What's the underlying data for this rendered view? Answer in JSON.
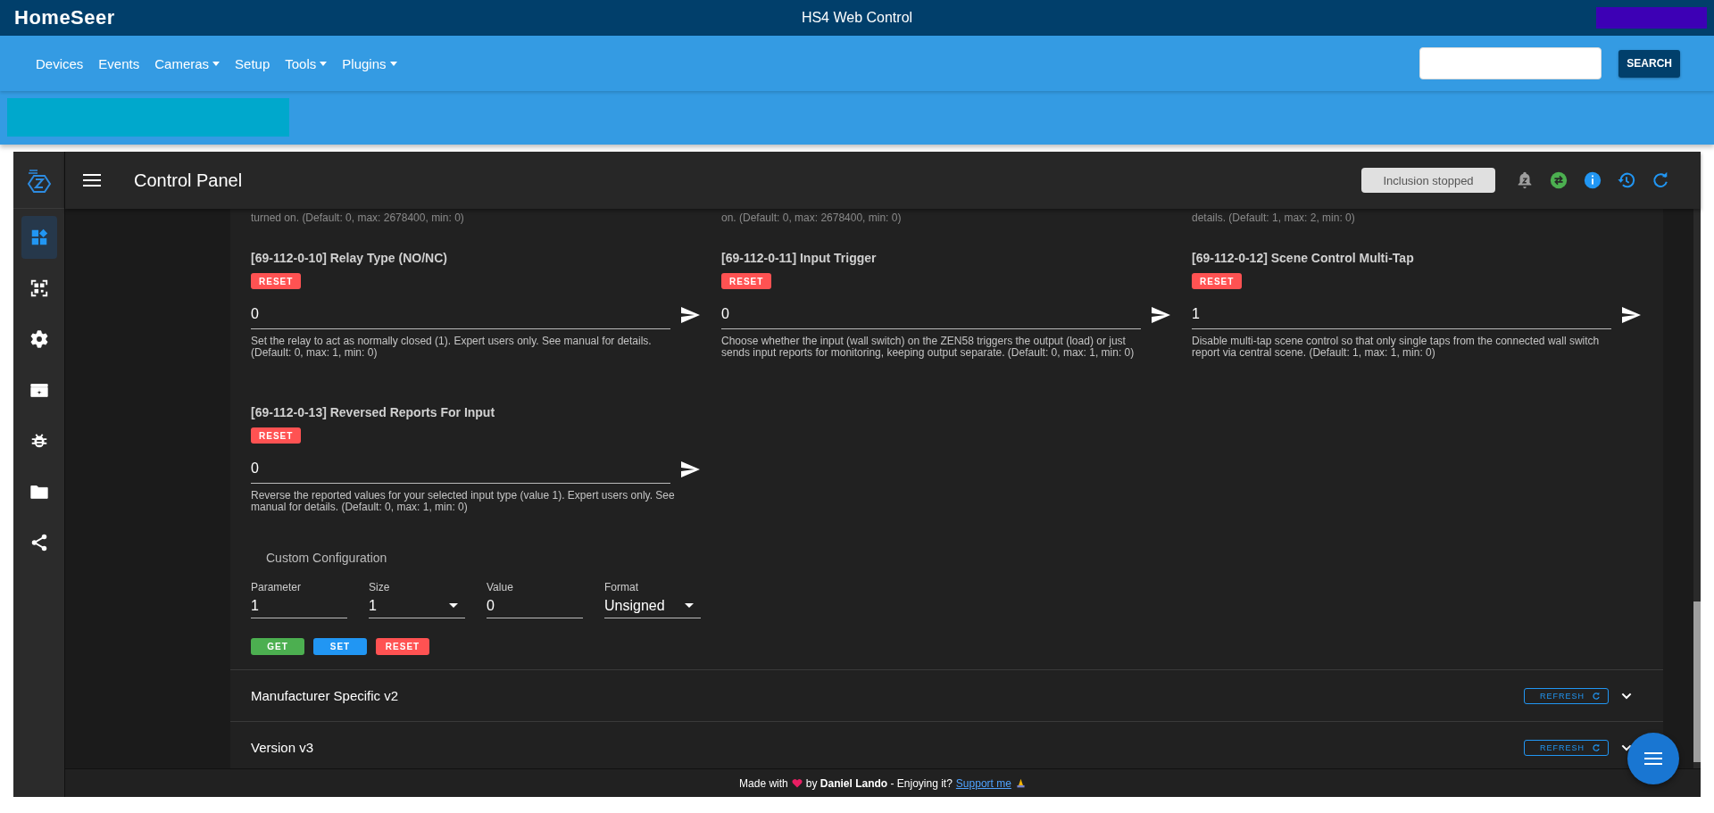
{
  "top_bar": {
    "logo": "HomeSeer",
    "title": "HS4 Web Control"
  },
  "nav": {
    "items": [
      {
        "label": "Devices",
        "dropdown": false
      },
      {
        "label": "Events",
        "dropdown": false
      },
      {
        "label": "Cameras",
        "dropdown": true
      },
      {
        "label": "Setup",
        "dropdown": false
      },
      {
        "label": "Tools",
        "dropdown": true
      },
      {
        "label": "Plugins",
        "dropdown": true
      }
    ],
    "search_button": "SEARCH"
  },
  "panel": {
    "title": "Control Panel",
    "inclusion_status": "Inclusion stopped",
    "sidebar": [
      {
        "kind": "dashboard",
        "selected": true
      },
      {
        "kind": "scan",
        "selected": false
      },
      {
        "kind": "settings",
        "selected": false
      },
      {
        "kind": "scenes",
        "selected": false
      },
      {
        "kind": "debug",
        "selected": false
      },
      {
        "kind": "files",
        "selected": false
      },
      {
        "kind": "share",
        "selected": false
      }
    ]
  },
  "cut_descriptions": [
    "turned on. (Default: 0, max: 2678400, min: 0)",
    "on. (Default: 0, max: 2678400, min: 0)",
    "details. (Default: 1, max: 2, min: 0)"
  ],
  "parameters": [
    {
      "title": "[69-112-0-10] Relay Type (NO/NC)",
      "reset": "RESET",
      "value": "0",
      "description": "Set the relay to act as normally closed (1). Expert users only. See manual for details. (Default: 0, max: 1, min: 0)"
    },
    {
      "title": "[69-112-0-11] Input Trigger",
      "reset": "RESET",
      "value": "0",
      "description": "Choose whether the input (wall switch) on the ZEN58 triggers the output (load) or just sends input reports for monitoring, keeping output separate. (Default: 0, max: 1, min: 0)"
    },
    {
      "title": "[69-112-0-12] Scene Control Multi-Tap",
      "reset": "RESET",
      "value": "1",
      "description": "Disable multi-tap scene control so that only single taps from the connected wall switch report via central scene. (Default: 1, max: 1, min: 0)"
    },
    {
      "title": "[69-112-0-13] Reversed Reports For Input",
      "reset": "RESET",
      "value": "0",
      "description": "Reverse the reported values for your selected input type (value 1). Expert users only. See manual for details. (Default: 0, max: 1, min: 0)"
    }
  ],
  "custom_configuration": {
    "title": "Custom Configuration",
    "fields": [
      {
        "label": "Parameter",
        "value": "1",
        "kind": "input"
      },
      {
        "label": "Size",
        "value": "1",
        "kind": "select"
      },
      {
        "label": "Value",
        "value": "0",
        "kind": "input"
      },
      {
        "label": "Format",
        "value": "Unsigned",
        "kind": "select"
      }
    ],
    "buttons": [
      {
        "label": "GET",
        "kind": "get"
      },
      {
        "label": "SET",
        "kind": "set"
      },
      {
        "label": "RESET",
        "kind": "reset"
      }
    ]
  },
  "sections": [
    {
      "title": "Manufacturer Specific v2",
      "button": "REFRESH"
    },
    {
      "title": "Version v3",
      "button": "REFRESH"
    }
  ],
  "footer": {
    "before": "Made with",
    "after": "by **Daniel Lando**  - Enjoying it?",
    "link": "Support me"
  }
}
